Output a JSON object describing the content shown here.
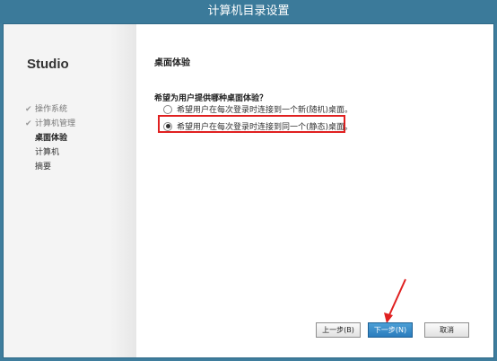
{
  "window": {
    "title": "计算机目录设置"
  },
  "sidebar": {
    "brand": "Studio",
    "steps": [
      {
        "label": "操作系统",
        "state": "done"
      },
      {
        "label": "计算机管理",
        "state": "done"
      },
      {
        "label": "桌面体验",
        "state": "current"
      },
      {
        "label": "计算机",
        "state": "pending"
      },
      {
        "label": "摘要",
        "state": "pending"
      }
    ]
  },
  "main": {
    "title": "桌面体验",
    "question": "希望为用户提供哪种桌面体验？",
    "options": [
      {
        "label": "希望用户在每次登录时连接到一个新(随机)桌面。",
        "selected": false
      },
      {
        "label": "希望用户在每次登录时连接到同一个(静态)桌面。",
        "selected": true
      }
    ]
  },
  "buttons": {
    "back": "上一步(B)",
    "next": "下一步(N)",
    "cancel": "取消"
  },
  "colors": {
    "titlebar": "#3b7a9a",
    "highlight": "#e02020",
    "primary_button": "#2b7cbd"
  }
}
